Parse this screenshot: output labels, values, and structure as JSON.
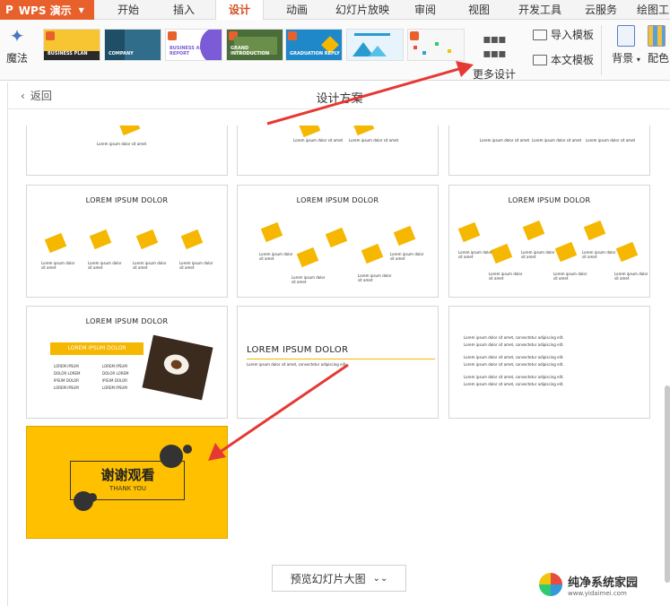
{
  "app": {
    "brand": "WPS 演示",
    "brand_prefix": "P"
  },
  "tabs": [
    {
      "label": "开始"
    },
    {
      "label": "插入"
    },
    {
      "label": "设计",
      "active": true
    },
    {
      "label": "动画"
    },
    {
      "label": "幻灯片放映"
    },
    {
      "label": "审阅"
    },
    {
      "label": "视图"
    },
    {
      "label": "开发工具"
    },
    {
      "label": "云服务"
    },
    {
      "label": "绘图工"
    }
  ],
  "ribbon": {
    "magic_label": "魔法",
    "more_design_label": "更多设计",
    "import_template_label": "导入模板",
    "this_template_label": "本文模板",
    "background_label": "背景",
    "color_label": "配色",
    "templates": [
      {
        "name": "BUSINESS PLAN",
        "bg": "#f7c531"
      },
      {
        "name": "COMPANY",
        "bg": "#2f6d8a"
      },
      {
        "name": "BUSINESS ANNUAL REPORT",
        "bg": "#7b5bd6"
      },
      {
        "name": "GRAND INTRODUCTION",
        "bg": "#4a6d3a"
      },
      {
        "name": "GRADUATION REPLY",
        "bg": "#1e88c9"
      },
      {
        "name": "",
        "bg": "#e8f4fb"
      },
      {
        "name": "",
        "bg": "#f7f7f7"
      }
    ]
  },
  "panel": {
    "back_label": "返回",
    "title": "设计方案",
    "preview_label": "预览幻灯片大图"
  },
  "slides": {
    "heading": "LOREM IPSUM DOLOR",
    "body_small": "Lorem ipsum dolor sit amet",
    "body_text": "Lorem ipsum dolor sit amet, consectetur adipiscing elit.",
    "table_rows": [
      "LOREM IPSUM",
      "DOLOR LOREM",
      "IPSUM DOLOR",
      "LOREM IPSUM"
    ],
    "thanks_cn": "谢谢观看",
    "thanks_en": "THANK YOU"
  },
  "watermark": {
    "title": "纯净系统家园",
    "url": "www.yidaimei.com"
  },
  "colors": {
    "accent": "#e8612c",
    "yellow": "#ffc000",
    "arrow": "#e53935"
  }
}
